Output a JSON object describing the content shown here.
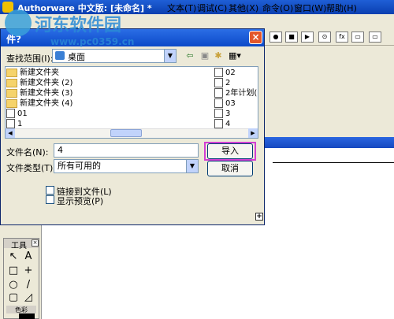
{
  "app": {
    "title": "Authorware 中文版: [未命名] *",
    "menus": [
      "文本(T)",
      "调试(C)",
      "其他(X)",
      "命令(O)",
      "窗口(W)",
      "帮助(H)"
    ]
  },
  "toolbar": {
    "buttons": [
      "●",
      "■",
      "▶",
      "⊙",
      "fx",
      "▭",
      "▭"
    ]
  },
  "dialog": {
    "title": "件?",
    "look_in_label": "查找范围(I):",
    "look_in_value": "桌面",
    "files_left": [
      "新建文件夹",
      "新建文件夹 (2)",
      "新建文件夹 (3)",
      "新建文件夹 (4)",
      "01",
      "1"
    ],
    "files_right": [
      "02",
      "2",
      "2年计划(",
      "03",
      "3",
      "4"
    ],
    "filename_label": "文件名(N):",
    "filename_value": "4",
    "filetype_label": "文件类型(T):",
    "filetype_value": "所有可用的",
    "import_button": "导入",
    "cancel_button": "取消",
    "link_checkbox": "链接到文件(L)",
    "preview_checkbox": "显示预览(P)",
    "expand_button": "+"
  },
  "tools": {
    "title": "工具",
    "color_label": "色彩",
    "tool_glyphs": [
      "↖",
      "A",
      "□",
      "+",
      "○",
      "/",
      "▢",
      "◿"
    ]
  },
  "watermark": {
    "text": "河东软件园",
    "url": "www.pc0359.cn"
  },
  "colors": {
    "titlebar": "#0a3fb0",
    "highlight": "#d33fd3",
    "dialog_bg": "#ece9d8"
  }
}
